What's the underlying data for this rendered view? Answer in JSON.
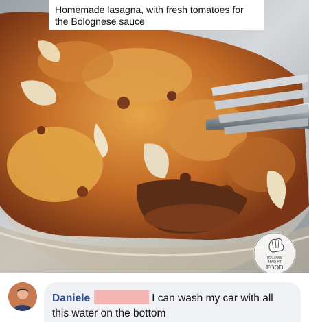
{
  "photo": {
    "caption": "Homemade lasagna, with fresh tomatoes for the Bolognese sauce",
    "subject": "lasagna-in-glass-dish"
  },
  "watermark": {
    "line1": "ITALIANS",
    "line2": "MAD AT",
    "line3": "FOOD"
  },
  "comment": {
    "author": "Daniele",
    "text": "I can wash my car with all this water on the bottom"
  },
  "colors": {
    "author_link": "#2c4d93",
    "bubble_bg": "#eff1f4",
    "redaction": "#f4b4b2"
  }
}
